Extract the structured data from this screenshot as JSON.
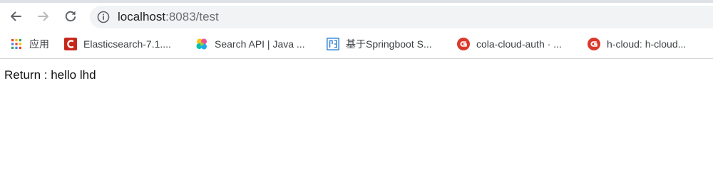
{
  "browser": {
    "address_bar": {
      "host": "localhost",
      "rest": ":8083/test"
    },
    "bookmarks": [
      {
        "label": "应用",
        "icon": "apps-grid-icon"
      },
      {
        "label": "Elasticsearch-7.1....",
        "icon": "csdn-icon"
      },
      {
        "label": "Search API | Java ...",
        "icon": "elastic-icon"
      },
      {
        "label": "基于Springboot S...",
        "icon": "jianshu-icon"
      },
      {
        "label": "cola-cloud-auth · ...",
        "icon": "gitee-icon"
      },
      {
        "label": "h-cloud: h-cloud...",
        "icon": "gitee-icon"
      }
    ]
  },
  "page": {
    "body_text": "Return : hello lhd"
  },
  "colors": {
    "csdn_red": "#c8261b",
    "gitee_red": "#d9392b",
    "omnibox_bg": "#f1f3f4"
  }
}
